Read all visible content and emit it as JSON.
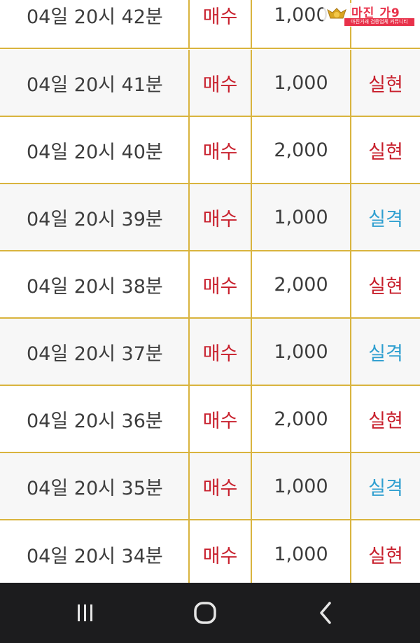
{
  "watermark": {
    "title": "마진 가9",
    "subtitle": "마진거래 검증업체 커뮤니티",
    "accent_color": "#e8314a",
    "emblem_icon": "gold-bull-emblem-icon"
  },
  "colors": {
    "grid_line": "#d9b43e",
    "buy_red": "#c8202d",
    "win_red": "#c8202d",
    "lose_blue": "#2f9fd0",
    "navbar": "#1c1c1e"
  },
  "rows": [
    {
      "time": "04일 20시 42분",
      "type": "매수",
      "amount": "1,000",
      "result": "",
      "result_kind": "none"
    },
    {
      "time": "04일 20시 41분",
      "type": "매수",
      "amount": "1,000",
      "result": "실현",
      "result_kind": "win"
    },
    {
      "time": "04일 20시 40분",
      "type": "매수",
      "amount": "2,000",
      "result": "실현",
      "result_kind": "win"
    },
    {
      "time": "04일 20시 39분",
      "type": "매수",
      "amount": "1,000",
      "result": "실격",
      "result_kind": "lose"
    },
    {
      "time": "04일 20시 38분",
      "type": "매수",
      "amount": "2,000",
      "result": "실현",
      "result_kind": "win"
    },
    {
      "time": "04일 20시 37분",
      "type": "매수",
      "amount": "1,000",
      "result": "실격",
      "result_kind": "lose"
    },
    {
      "time": "04일 20시 36분",
      "type": "매수",
      "amount": "2,000",
      "result": "실현",
      "result_kind": "win"
    },
    {
      "time": "04일 20시 35분",
      "type": "매수",
      "amount": "1,000",
      "result": "실격",
      "result_kind": "lose"
    },
    {
      "time": "04일 20시 34분",
      "type": "매수",
      "amount": "1,000",
      "result": "실현",
      "result_kind": "win"
    }
  ],
  "navbar": {
    "recents_icon": "recent-apps-icon",
    "home_icon": "home-icon",
    "back_icon": "back-icon"
  }
}
